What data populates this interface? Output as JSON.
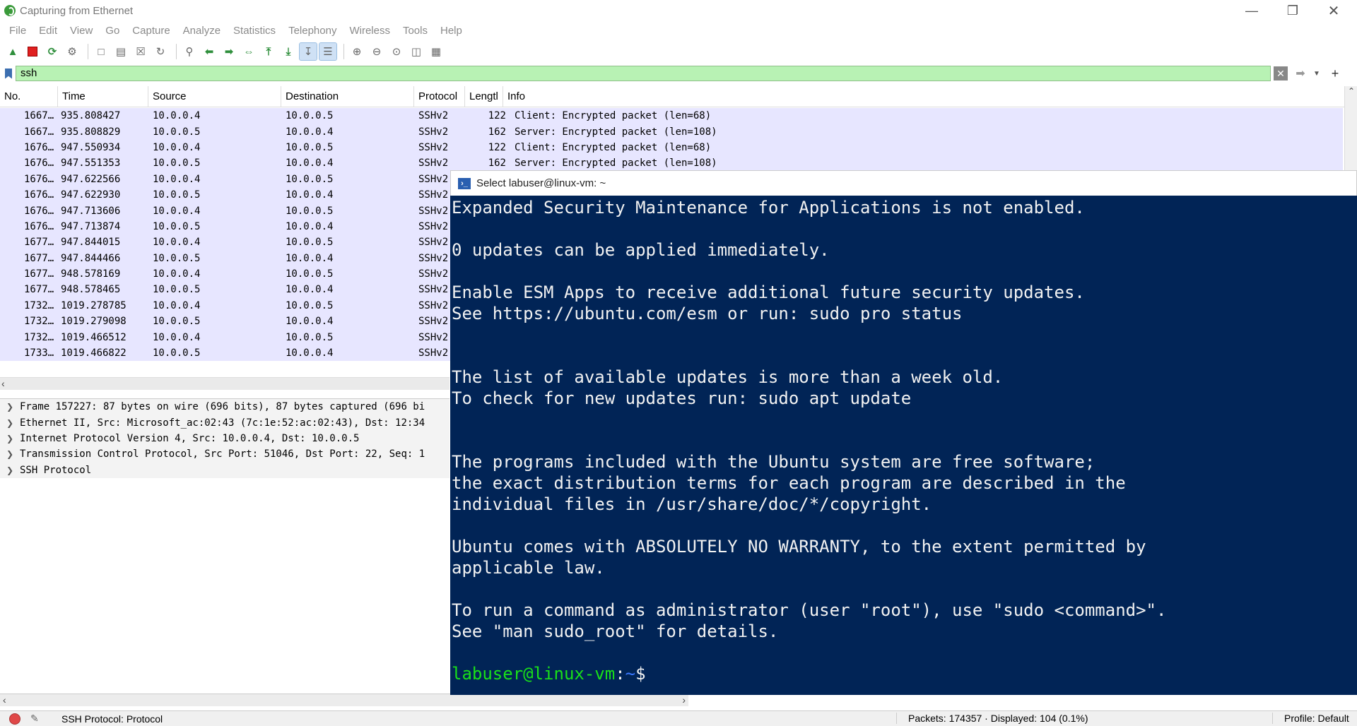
{
  "window": {
    "title": "Capturing from Ethernet"
  },
  "menu": [
    "File",
    "Edit",
    "View",
    "Go",
    "Capture",
    "Analyze",
    "Statistics",
    "Telephony",
    "Wireless",
    "Tools",
    "Help"
  ],
  "filter": {
    "value": "ssh"
  },
  "packet_list": {
    "columns": [
      "No.",
      "Time",
      "Source",
      "Destination",
      "Protocol",
      "Lengtl",
      "Info"
    ],
    "rows": [
      {
        "no": "1667…",
        "time": "935.808427",
        "src": "10.0.0.4",
        "dst": "10.0.0.5",
        "proto": "SSHv2",
        "len": "122",
        "info": "Client: Encrypted packet (len=68)"
      },
      {
        "no": "1667…",
        "time": "935.808829",
        "src": "10.0.0.5",
        "dst": "10.0.0.4",
        "proto": "SSHv2",
        "len": "162",
        "info": "Server: Encrypted packet (len=108)"
      },
      {
        "no": "1676…",
        "time": "947.550934",
        "src": "10.0.0.4",
        "dst": "10.0.0.5",
        "proto": "SSHv2",
        "len": "122",
        "info": "Client: Encrypted packet (len=68)"
      },
      {
        "no": "1676…",
        "time": "947.551353",
        "src": "10.0.0.5",
        "dst": "10.0.0.4",
        "proto": "SSHv2",
        "len": "162",
        "info": "Server: Encrypted packet (len=108)"
      },
      {
        "no": "1676…",
        "time": "947.622566",
        "src": "10.0.0.4",
        "dst": "10.0.0.5",
        "proto": "SSHv2",
        "len": "",
        "info": ""
      },
      {
        "no": "1676…",
        "time": "947.622930",
        "src": "10.0.0.5",
        "dst": "10.0.0.4",
        "proto": "SSHv2",
        "len": "",
        "info": ""
      },
      {
        "no": "1676…",
        "time": "947.713606",
        "src": "10.0.0.4",
        "dst": "10.0.0.5",
        "proto": "SSHv2",
        "len": "",
        "info": ""
      },
      {
        "no": "1676…",
        "time": "947.713874",
        "src": "10.0.0.5",
        "dst": "10.0.0.4",
        "proto": "SSHv2",
        "len": "",
        "info": ""
      },
      {
        "no": "1677…",
        "time": "947.844015",
        "src": "10.0.0.4",
        "dst": "10.0.0.5",
        "proto": "SSHv2",
        "len": "",
        "info": ""
      },
      {
        "no": "1677…",
        "time": "947.844466",
        "src": "10.0.0.5",
        "dst": "10.0.0.4",
        "proto": "SSHv2",
        "len": "",
        "info": ""
      },
      {
        "no": "1677…",
        "time": "948.578169",
        "src": "10.0.0.4",
        "dst": "10.0.0.5",
        "proto": "SSHv2",
        "len": "",
        "info": ""
      },
      {
        "no": "1677…",
        "time": "948.578465",
        "src": "10.0.0.5",
        "dst": "10.0.0.4",
        "proto": "SSHv2",
        "len": "",
        "info": ""
      },
      {
        "no": "1732…",
        "time": "1019.278785",
        "src": "10.0.0.4",
        "dst": "10.0.0.5",
        "proto": "SSHv2",
        "len": "",
        "info": ""
      },
      {
        "no": "1732…",
        "time": "1019.279098",
        "src": "10.0.0.5",
        "dst": "10.0.0.4",
        "proto": "SSHv2",
        "len": "",
        "info": ""
      },
      {
        "no": "1732…",
        "time": "1019.466512",
        "src": "10.0.0.4",
        "dst": "10.0.0.5",
        "proto": "SSHv2",
        "len": "",
        "info": ""
      },
      {
        "no": "1733…",
        "time": "1019.466822",
        "src": "10.0.0.5",
        "dst": "10.0.0.4",
        "proto": "SSHv2",
        "len": "",
        "info": ""
      }
    ]
  },
  "details": [
    "Frame 157227: 87 bytes on wire (696 bits), 87 bytes captured (696 bi",
    "Ethernet II, Src: Microsoft_ac:02:43 (7c:1e:52:ac:02:43), Dst: 12:34",
    "Internet Protocol Version 4, Src: 10.0.0.4, Dst: 10.0.0.5",
    "Transmission Control Protocol, Src Port: 51046, Dst Port: 22, Seq: 1",
    "SSH Protocol"
  ],
  "status": {
    "text": "SSH Protocol: Protocol",
    "packets": "Packets: 174357 · Displayed: 104 (0.1%)",
    "profile": "Profile: Default"
  },
  "terminal": {
    "title": "Select labuser@linux-vm: ~",
    "lines": [
      "Expanded Security Maintenance for Applications is not enabled.",
      "",
      "0 updates can be applied immediately.",
      "",
      "Enable ESM Apps to receive additional future security updates.",
      "See https://ubuntu.com/esm or run: sudo pro status",
      "",
      "",
      "The list of available updates is more than a week old.",
      "To check for new updates run: sudo apt update",
      "",
      "",
      "The programs included with the Ubuntu system are free software;",
      "the exact distribution terms for each program are described in the",
      "individual files in /usr/share/doc/*/copyright.",
      "",
      "Ubuntu comes with ABSOLUTELY NO WARRANTY, to the extent permitted by",
      "applicable law.",
      "",
      "To run a command as administrator (user \"root\"), use \"sudo <command>\".",
      "See \"man sudo_root\" for details.",
      ""
    ],
    "prompt_user": "labuser@linux-vm",
    "prompt_sep": ":",
    "prompt_path": "~",
    "prompt_end": "$"
  }
}
